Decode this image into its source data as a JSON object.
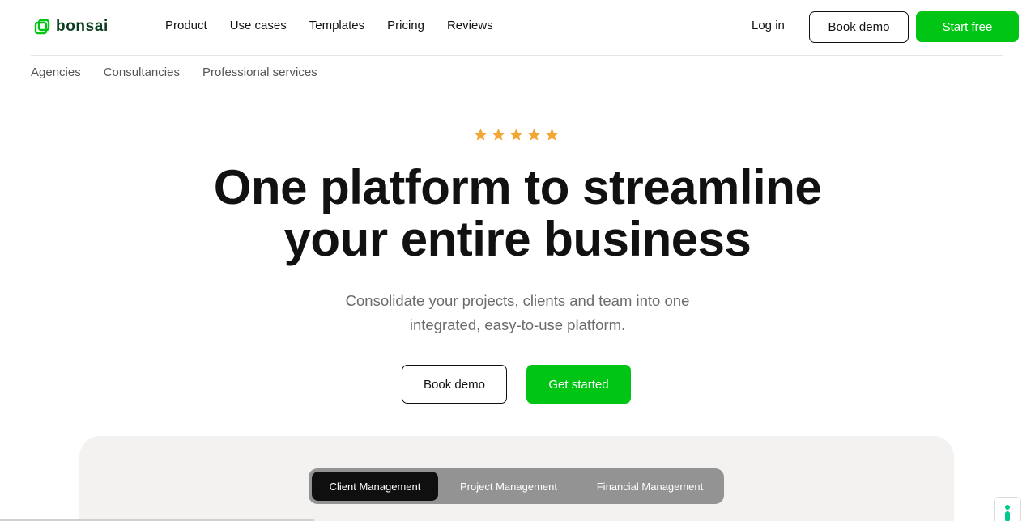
{
  "brand": {
    "name": "bonsai",
    "color": "#00c514",
    "logo_icon": "bonsai-logo-icon"
  },
  "header": {
    "nav": [
      "Product",
      "Use cases",
      "Templates",
      "Pricing",
      "Reviews"
    ],
    "login_label": "Log in",
    "book_demo_label": "Book demo",
    "start_free_label": "Start free"
  },
  "subnav": [
    "Agencies",
    "Consultancies",
    "Professional services"
  ],
  "hero": {
    "rating_stars": 5,
    "star_color": "#f2a634",
    "title_line1": "One platform to streamline",
    "title_line2": "your entire business",
    "subtitle_line1": "Consolidate your projects, clients and team into one",
    "subtitle_line2": "integrated, easy-to-use platform.",
    "book_demo_label": "Book demo",
    "get_started_label": "Get started"
  },
  "product_tabs": {
    "active": "Client Management",
    "items": [
      "Client Management",
      "Project Management",
      "Financial Management"
    ]
  },
  "help_widget": {
    "icon": "person-icon",
    "color": "#00c98d"
  }
}
